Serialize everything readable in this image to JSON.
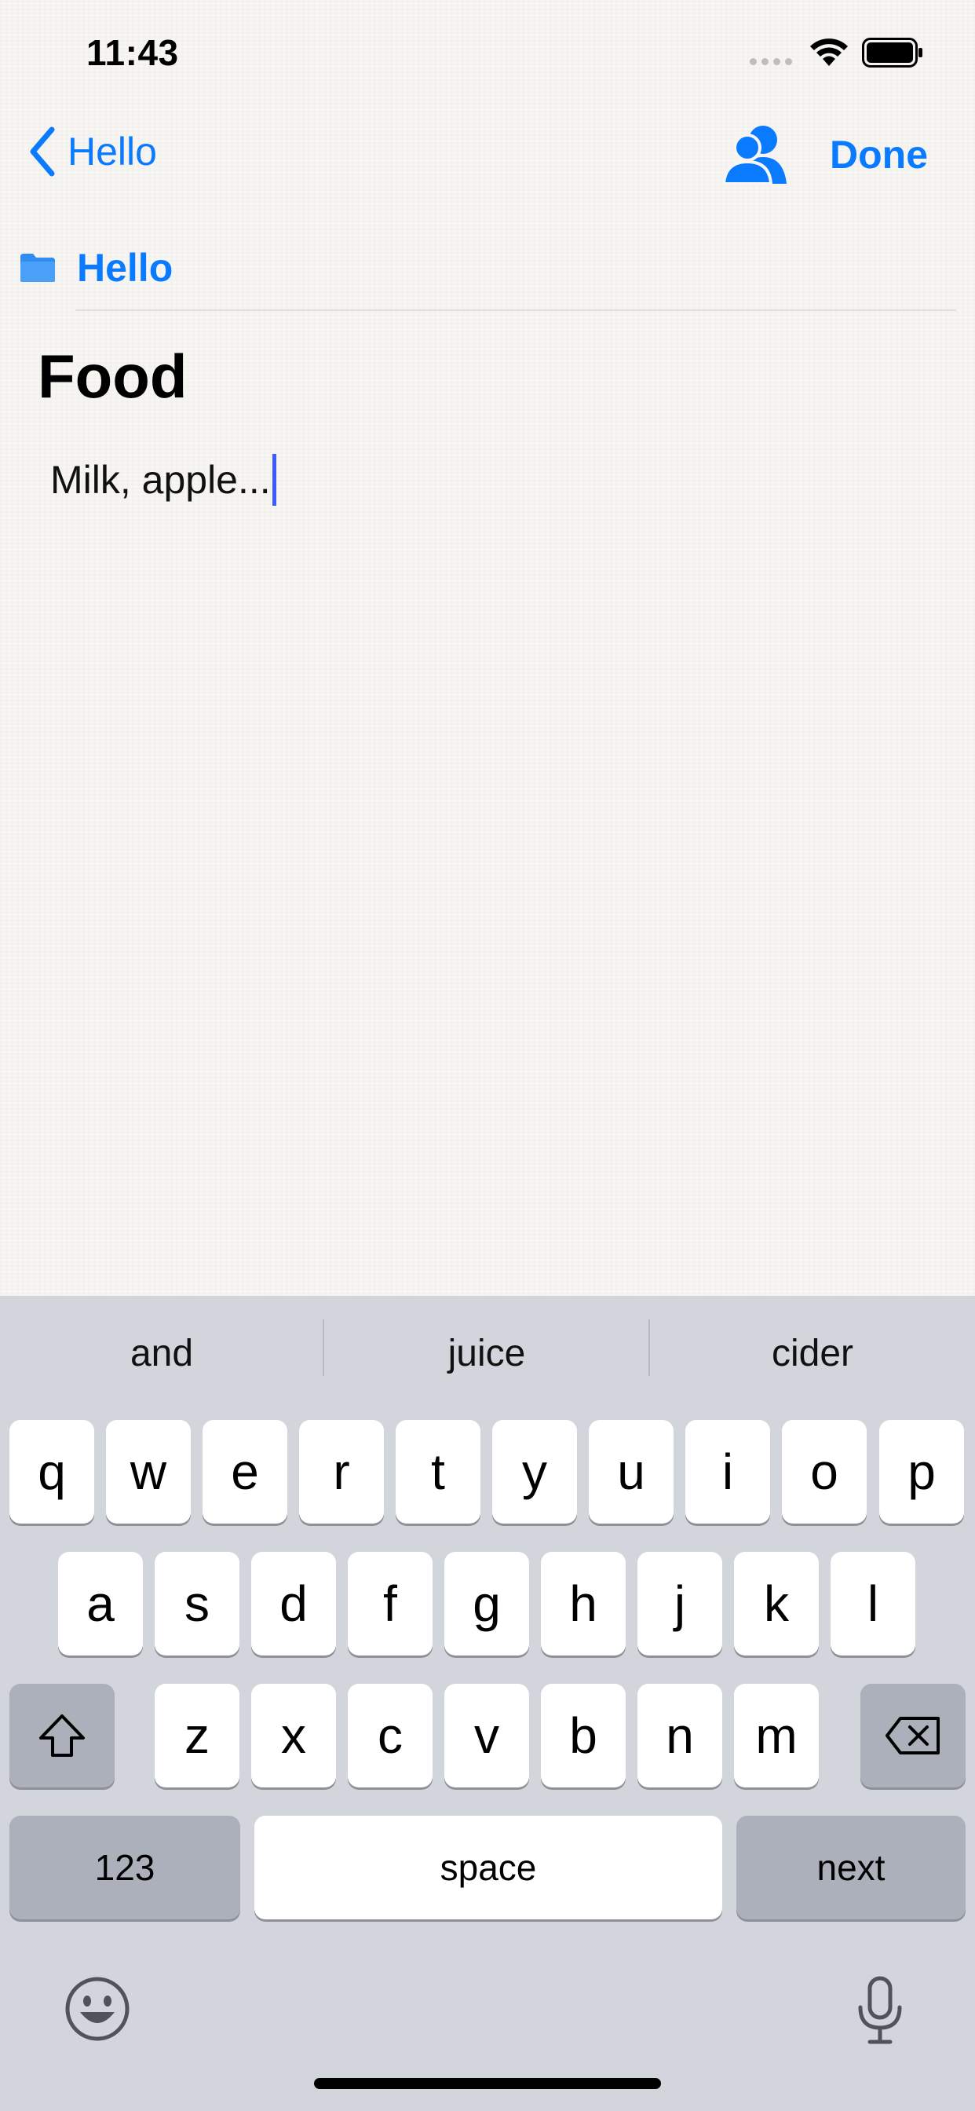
{
  "status_bar": {
    "time": "11:43"
  },
  "nav": {
    "back_label": "Hello",
    "done_label": "Done"
  },
  "folder": {
    "label": "Hello"
  },
  "note": {
    "title": "Food",
    "body": "Milk, apple..."
  },
  "keyboard": {
    "suggestions": [
      "and",
      "juice",
      "cider"
    ],
    "row1": [
      "q",
      "w",
      "e",
      "r",
      "t",
      "y",
      "u",
      "i",
      "o",
      "p"
    ],
    "row2": [
      "a",
      "s",
      "d",
      "f",
      "g",
      "h",
      "j",
      "k",
      "l"
    ],
    "row3": [
      "z",
      "x",
      "c",
      "v",
      "b",
      "n",
      "m"
    ],
    "numbers_label": "123",
    "space_label": "space",
    "return_label": "next"
  },
  "colors": {
    "accent": "#0a7bff",
    "caret": "#3b5bff",
    "keyboard_bg": "#d2d5db"
  },
  "icons": [
    "wifi-icon",
    "battery-icon",
    "chevron-left-icon",
    "share-people-icon",
    "folder-icon",
    "shift-icon",
    "delete-icon",
    "emoji-icon",
    "microphone-icon"
  ]
}
